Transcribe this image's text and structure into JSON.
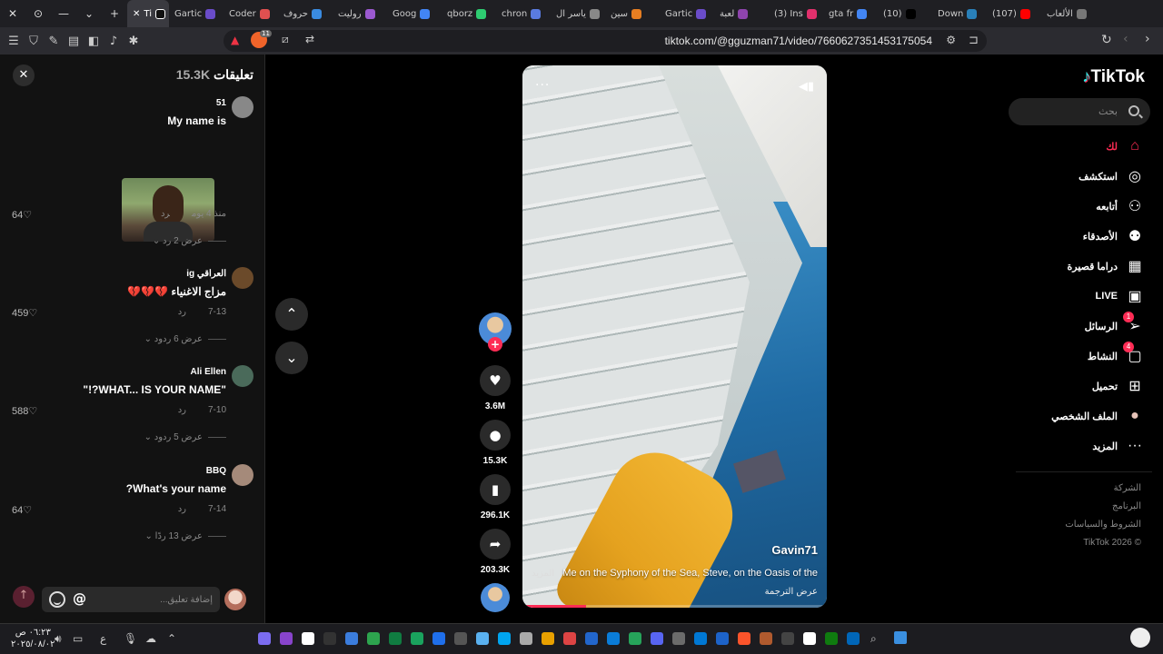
{
  "browser": {
    "tabs": [
      {
        "label": "Ti",
        "active": true,
        "color": "#111111"
      },
      {
        "label": "Gartic",
        "color": "#6a4cc9"
      },
      {
        "label": "Coder",
        "color": "#e05050"
      },
      {
        "label": "حروف",
        "color": "#3a8be0"
      },
      {
        "label": "روليت",
        "color": "#9b59d0"
      },
      {
        "label": "Goog",
        "color": "#4285f4"
      },
      {
        "label": "qborz",
        "color": "#2ecc71"
      },
      {
        "label": "chron",
        "color": "#5a7be0"
      },
      {
        "label": "ياسر ال",
        "color": "#888888"
      },
      {
        "label": "سين",
        "color": "#e67e22"
      },
      {
        "label": "Gartic",
        "color": "#6a4cc9"
      },
      {
        "label": "لعبة",
        "color": "#8e44ad"
      },
      {
        "label": "(3) Ins",
        "color": "#e1306c"
      },
      {
        "label": "gta fr",
        "color": "#4285f4"
      },
      {
        "label": "(10)",
        "color": "#000000"
      },
      {
        "label": "Down",
        "color": "#2980b9"
      },
      {
        "label": "(107)",
        "color": "#ff0000"
      },
      {
        "label": "الألعاب",
        "color": "#777777"
      }
    ],
    "url": "tiktok.com/@gguzman71/video/7660627351453175054",
    "shields_count": "11"
  },
  "comments_panel": {
    "title": "تعليقات",
    "count": "15.3K",
    "input_placeholder": "إضافة تعليق...",
    "at_label": "@",
    "comments": [
      {
        "user": "51",
        "text": "My name is",
        "time": "منذ 4 يوم",
        "reply": "رد",
        "likes": "64",
        "view_replies": "عرض 2 رد",
        "avatar_color": "#888888",
        "has_image": true
      },
      {
        "user": "العراقي ig",
        "text": "مزاج الاغنياء 💔💔💔",
        "time": "7-13",
        "reply": "رد",
        "likes": "459",
        "view_replies": "عرض 6 ردود",
        "avatar_color": "#6b4a2a"
      },
      {
        "user": "Ali Ellen",
        "text": "\"WHAT... IS YOUR NAME?!\"",
        "time": "7-10",
        "reply": "رد",
        "likes": "588",
        "view_replies": "عرض 5 ردود",
        "avatar_color": "#4a6a5a"
      },
      {
        "user": "BBQ",
        "text": "What's your name?",
        "time": "7-14",
        "reply": "رد",
        "likes": "64",
        "view_replies": "عرض 13 ردًا",
        "avatar_color": "#a58a7a"
      }
    ]
  },
  "video": {
    "author": "Gavin71",
    "caption": "Me on the Syphony of the Sea, Steve, on the Oasis of the",
    "more_label": "المزيد",
    "translate_label": "عرض الترجمة",
    "progress": 0.21
  },
  "actions": {
    "likes": "3.6M",
    "comments": "15.3K",
    "saves": "296.1K",
    "shares": "203.3K"
  },
  "sidebar": {
    "logo": "TikTok",
    "search_placeholder": "بحث",
    "items": [
      {
        "label": "لك",
        "icon": "home-icon",
        "active": true
      },
      {
        "label": "استكشف",
        "icon": "compass-icon"
      },
      {
        "label": "أتابعه",
        "icon": "user-follow-icon"
      },
      {
        "label": "الأصدقاء",
        "icon": "friends-icon"
      },
      {
        "label": "دراما قصيرة",
        "icon": "film-icon"
      },
      {
        "label": "LIVE",
        "icon": "live-tv-icon"
      },
      {
        "label": "الرسائل",
        "icon": "send-icon",
        "badge": "1"
      },
      {
        "label": "النشاط",
        "icon": "activity-icon",
        "badge": "4"
      },
      {
        "label": "تحميل",
        "icon": "upload-icon"
      },
      {
        "label": "الملف الشخصي",
        "icon": "profile-avatar"
      },
      {
        "label": "المزيد",
        "icon": "more-icon"
      }
    ],
    "footer": [
      "الشركة",
      "البرنامج",
      "الشروط والسياسات",
      "© 2026 TikTok"
    ]
  },
  "taskbar": {
    "time": "٠٦:٢٣ ص",
    "date": "٢٠٢٥/٠٨/٠٢",
    "lang": "ع"
  }
}
